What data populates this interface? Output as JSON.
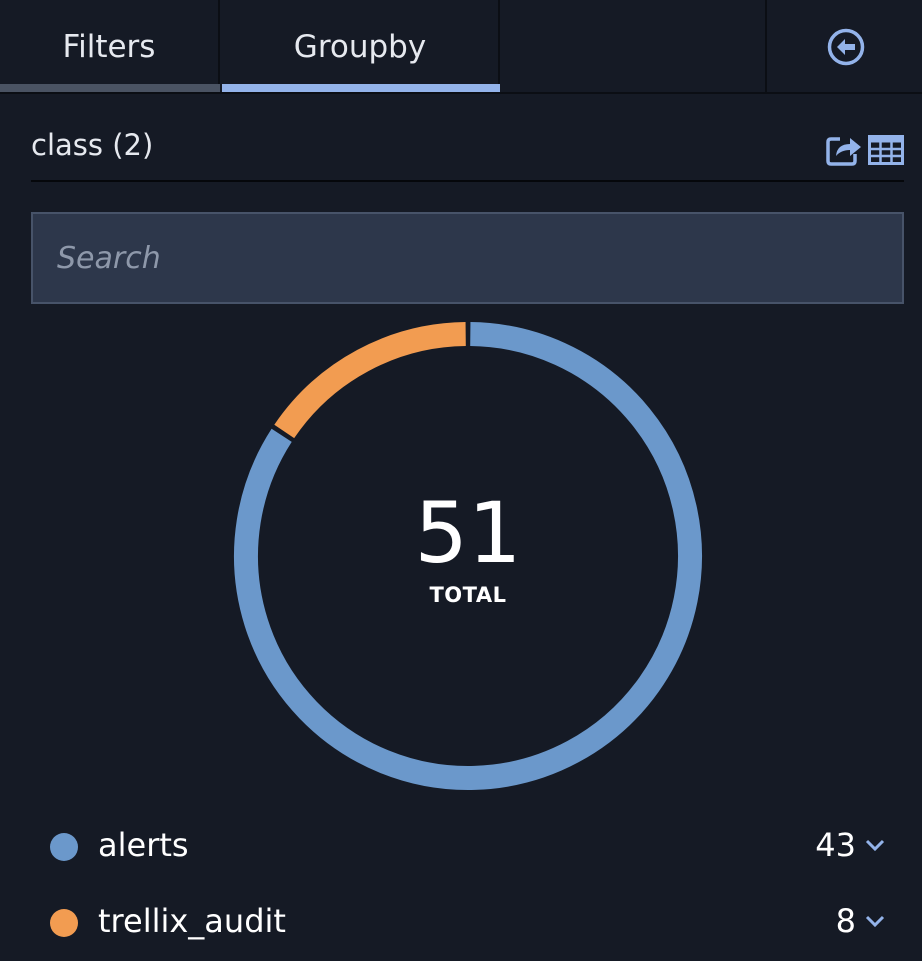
{
  "tabs": {
    "filters_label": "Filters",
    "groupby_label": "Groupby",
    "active": "Groupby"
  },
  "panel": {
    "title": "class (2)",
    "export_icon": "share-export-icon",
    "table_icon": "table-grid-icon",
    "back_icon": "back-arrow-circle-icon"
  },
  "search": {
    "placeholder": "Search",
    "value": ""
  },
  "summary": {
    "total_value": "51",
    "total_label": "TOTAL"
  },
  "colors": {
    "accent": "#93b3ea",
    "alerts": "#6b98cb",
    "trellix_audit": "#f29c51",
    "background": "#151a25",
    "search_bg": "#2d374b"
  },
  "chart_data": {
    "type": "pie",
    "variant": "donut",
    "total": 51,
    "categories": [
      "alerts",
      "trellix_audit"
    ],
    "values": [
      43,
      8
    ],
    "colors": [
      "#6b98cb",
      "#f29c51"
    ]
  },
  "legend": {
    "items": [
      {
        "label": "alerts",
        "count": "43",
        "color": "#6b98cb"
      },
      {
        "label": "trellix_audit",
        "count": "8",
        "color": "#f29c51"
      }
    ]
  }
}
